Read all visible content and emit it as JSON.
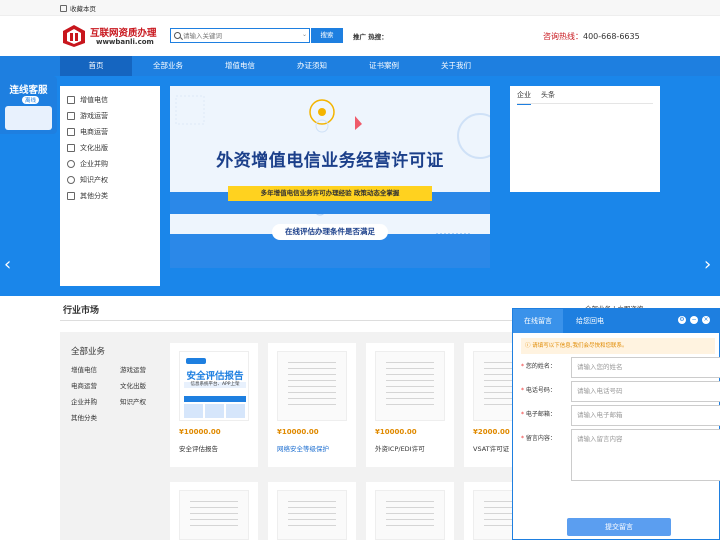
{
  "topbar": {
    "favorite_label": "收藏本页"
  },
  "header": {
    "logo_title": "互联网资质办理",
    "logo_url": "wwwbanli.com",
    "search_placeholder": "请输入关键词",
    "search_button": "搜索",
    "promo_label": "推广 热搜：",
    "hotline_label": "咨询热线：",
    "hotline_number": "400-668-6635"
  },
  "nav": {
    "items": [
      {
        "label": "首页",
        "active": true
      },
      {
        "label": "全部业务"
      },
      {
        "label": "增值电信"
      },
      {
        "label": "办证须知"
      },
      {
        "label": "证书案例"
      },
      {
        "label": "关于我们"
      }
    ]
  },
  "sidebar_categories": [
    {
      "label": "增值电信",
      "icon": "document-icon"
    },
    {
      "label": "游戏运营",
      "icon": "gamepad-icon"
    },
    {
      "label": "电商运营",
      "icon": "cart-icon"
    },
    {
      "label": "文化出版",
      "icon": "book-icon"
    },
    {
      "label": "企业并购",
      "icon": "bulb-icon"
    },
    {
      "label": "知识产权",
      "icon": "key-icon"
    },
    {
      "label": "其他分类",
      "icon": "grid-icon"
    }
  ],
  "banner": {
    "title": "外资增值电信业务经营许可证",
    "subtitle": "多年增值电信业务许可办理经验    政策动态全掌握",
    "pill": "在线评估办理条件是否满足"
  },
  "news": {
    "tabs": [
      "企业",
      "头条"
    ]
  },
  "livechat": {
    "title": "连线客服",
    "status": "离线"
  },
  "market": {
    "title": "行业市场",
    "links": "全部业务  |  立即咨询",
    "all_title": "全部业务",
    "all_items": [
      "增值电信",
      "游戏运营",
      "电商运营",
      "文化出版",
      "企业并购",
      "知识产权",
      "其他分类"
    ]
  },
  "products": [
    {
      "price": "¥10000.00",
      "name": "安全评估报告",
      "blue": false
    },
    {
      "price": "¥10000.00",
      "name": "网络安全等级保护",
      "blue": true
    },
    {
      "price": "¥10000.00",
      "name": "外资ICP/EDI许可",
      "blue": false
    },
    {
      "price": "¥2000.00",
      "name": "VSAT许可证",
      "blue": false
    }
  ],
  "report_card": {
    "title": "安全评估报告",
    "sub": "信息系统平台、APP上架"
  },
  "message_panel": {
    "tab_message": "在线留言",
    "tab_callback": "给您回电",
    "notice": "请填写以下信息,我们会尽快和您联系。",
    "fields": [
      {
        "label": "您的姓名：",
        "placeholder": "请输入您的姓名"
      },
      {
        "label": "电话号码：",
        "placeholder": "请输入电话号码"
      },
      {
        "label": "电子邮箱：",
        "placeholder": "请输入电子邮箱"
      }
    ],
    "message_label": "留言内容：",
    "message_placeholder": "请输入留言内容",
    "submit": "提交留言"
  },
  "colors": {
    "primary": "#1e7fe0",
    "brand_red": "#c8161d",
    "price": "#e08a00"
  }
}
